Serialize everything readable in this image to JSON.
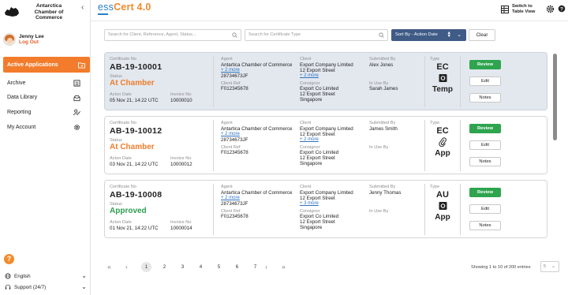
{
  "sidebar": {
    "org_name": "Antarctica Chamber of Commerce",
    "user": {
      "name": "Jenny Lee",
      "logout": "Log Out"
    },
    "items": [
      {
        "label": "Active Applications",
        "icon": "folder-icon",
        "active": true
      },
      {
        "label": "Archive",
        "icon": "archive-icon"
      },
      {
        "label": "Data Library",
        "icon": "inbox-icon"
      },
      {
        "label": "Reporting",
        "icon": "users-report-icon"
      },
      {
        "label": "My Account",
        "icon": "gear-icon"
      }
    ],
    "language": "English",
    "support": "Support (24/7)"
  },
  "header": {
    "brand_prefix": "ess",
    "brand_name": "Cert 4.0",
    "switch_label": "Switch to Table View"
  },
  "filters": {
    "search_placeholder": "Search for Client, Reference, Agent, Status...",
    "cert_type_placeholder": "Search for Certificate Type",
    "sort_label": "Sort By - Action Date",
    "clear_label": "Clear"
  },
  "labels": {
    "cert_no": "Certificate No",
    "status": "Status",
    "action_date": "Acton Date",
    "invoice_no": "Invoice No",
    "agent": "Agent",
    "client_ref": "Client Ref",
    "client": "Client",
    "consignor": "Consignor",
    "submitted_by": "Submitted By",
    "in_use_by": "In Use By",
    "type": "Type",
    "review": "Review",
    "edit": "Edit",
    "notes": "Notes"
  },
  "cards": [
    {
      "cert_no": "AB-19-10001",
      "status": "At Chamber",
      "status_color": "#f07d2a",
      "action_date": "05 Nov 21, 14:22 UTC",
      "invoice_no": "10000010",
      "agent": "Antartica Chamber of Commerce",
      "agent_more": "+ 2 more",
      "agent_code": "28734673JF",
      "client_ref": "F012345678",
      "client": "Export Company Limited",
      "client_line2": "12 Export Street",
      "client_more": "+ 2 more",
      "consignor": "Export Co Limited",
      "consignor_line2": "12 Export Street",
      "consignor_line3": "Singapore",
      "submitted_by": "Alex Jones",
      "in_use_by": "Sarah James",
      "type_code": "EC",
      "type_icon": "stamp-icon",
      "type_word": "Temp"
    },
    {
      "cert_no": "AB-19-10012",
      "status": "At Chamber",
      "status_color": "#f07d2a",
      "action_date": "03 Nov 21, 14:22 UTC",
      "invoice_no": "10000012",
      "agent": "Antartica Chamber of Commerce",
      "agent_more": "+ 2 more",
      "agent_code": "28734673JF",
      "client_ref": "F012345678",
      "client": "Export Company Limited",
      "client_line2": "12 Export Street",
      "client_more": "+ 2 more",
      "consignor": "Export Co Limited",
      "consignor_line2": "12 Export Street",
      "consignor_line3": "Singapore",
      "submitted_by": "James Smith",
      "in_use_by": "",
      "type_code": "EC",
      "type_icon": "paperclip-icon",
      "type_word": "App"
    },
    {
      "cert_no": "AB-19-10008",
      "status": "Approved",
      "status_color": "#2e9e4f",
      "action_date": "01 Nov 21, 14:22 UTC",
      "invoice_no": "10000014",
      "agent": "Antartica Chamber of Commerce",
      "agent_more": "+ 2 more",
      "agent_code": "28734673JF",
      "client_ref": "F012345678",
      "client": "Export Company Limited",
      "client_line2": "12 Export Street",
      "client_more": "+ 3 more",
      "consignor": "Export Co Limited",
      "consignor_line2": "12 Export Street",
      "consignor_line3": "Singapore",
      "submitted_by": "Jenny Thomas",
      "in_use_by": "",
      "type_code": "AU",
      "type_icon": "stamp-icon",
      "type_word": "App"
    }
  ],
  "pagination": {
    "pages": [
      "1",
      "2",
      "3",
      "4",
      "5",
      "6",
      "7"
    ],
    "current": "1",
    "showing": "Showing 1 to 10 of 200 entries",
    "per_page": "5"
  }
}
